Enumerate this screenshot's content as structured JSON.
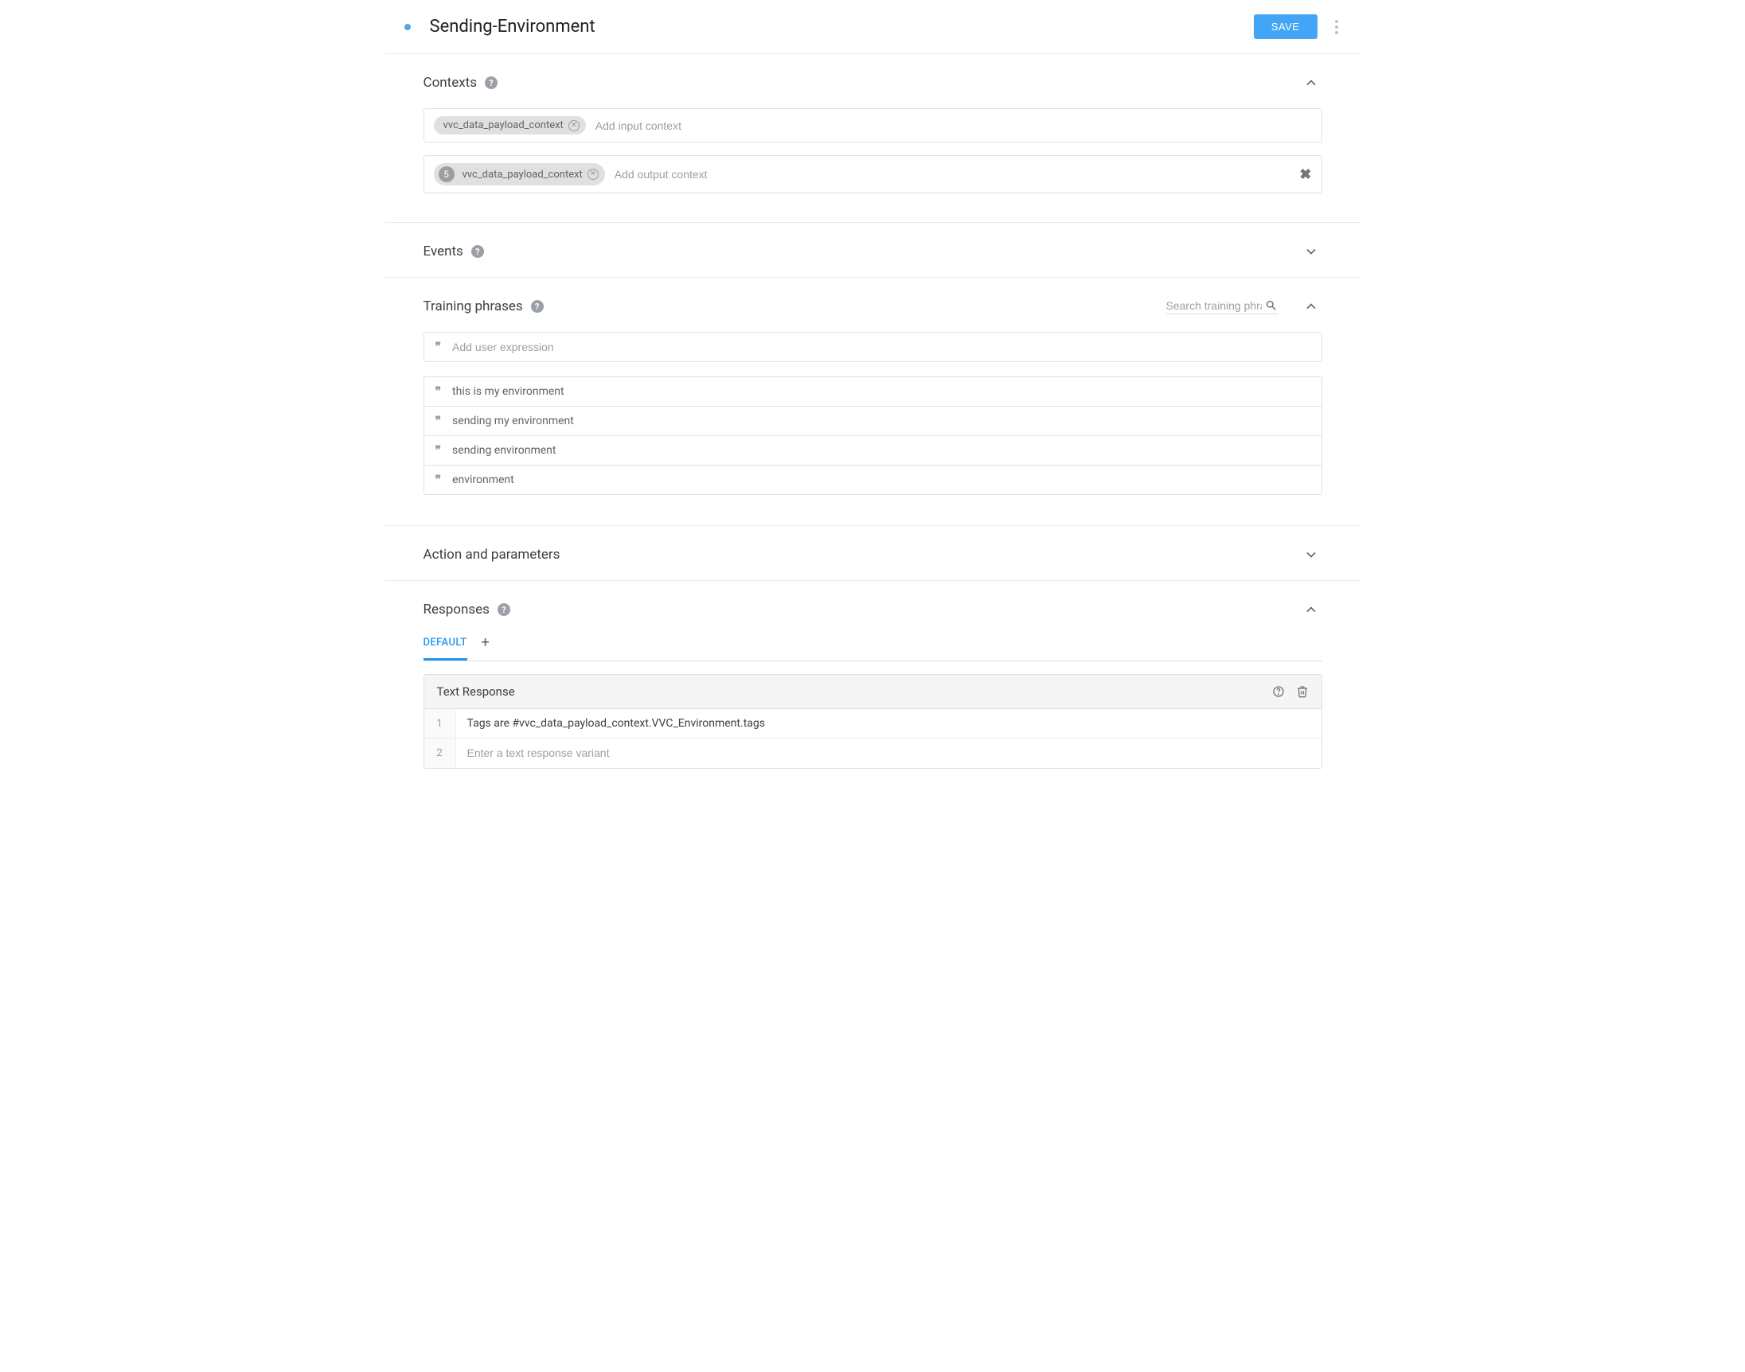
{
  "header": {
    "title": "Sending-Environment",
    "save_label": "SAVE"
  },
  "contexts": {
    "title": "Contexts",
    "input": {
      "chip": "vvc_data_payload_context",
      "placeholder": "Add input context"
    },
    "output": {
      "lifespan": "5",
      "chip": "vvc_data_payload_context",
      "placeholder": "Add output context"
    }
  },
  "events": {
    "title": "Events"
  },
  "training": {
    "title": "Training phrases",
    "search_placeholder": "Search training phrases",
    "add_placeholder": "Add user expression",
    "phrases": [
      "this is my environment",
      "sending my environment",
      "sending environment",
      "environment"
    ]
  },
  "action": {
    "title": "Action and parameters"
  },
  "responses": {
    "title": "Responses",
    "tab_default": "DEFAULT",
    "text_response_label": "Text Response",
    "rows": [
      {
        "n": "1",
        "text": "Tags are #vvc_data_payload_context.VVC_Environment.tags"
      },
      {
        "n": "2",
        "placeholder": "Enter a text response variant"
      }
    ]
  }
}
